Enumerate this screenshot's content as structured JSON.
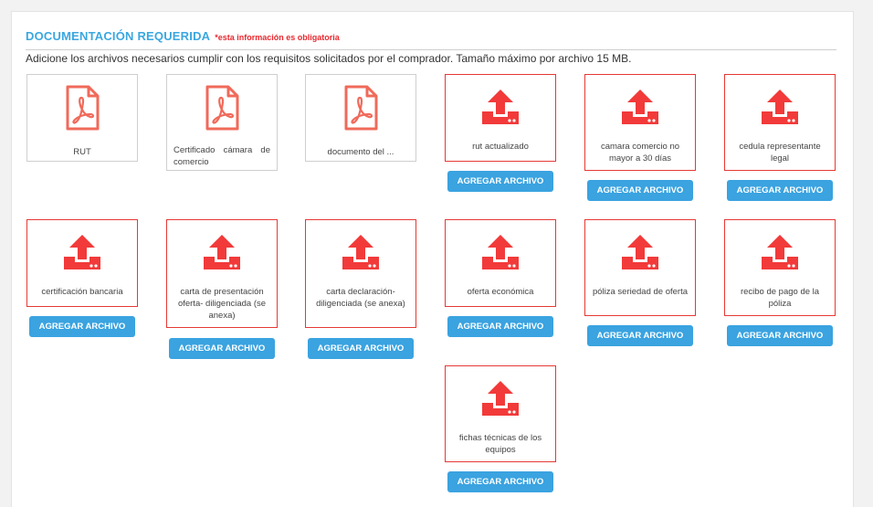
{
  "section": {
    "title": "DOCUMENTACIÓN REQUERIDA",
    "required_note": "*esta información es obligatoria",
    "description": "Adicione los archivos necesarios cumplir con los requisitos solicitados por el comprador. Tamaño máximo por archivo 15 MB."
  },
  "colors": {
    "accent": "#3aa7e0",
    "button": "#3aa3e0",
    "required": "#e8282e",
    "upload_icon": "#f23a3a",
    "pdf_icon": "#f06a5a"
  },
  "button_label": "AGREGAR ARCHIVO",
  "documents": [
    {
      "label": "RUT",
      "status": "uploaded",
      "icon": "pdf-icon"
    },
    {
      "label": "Certificado     cámara de comercio",
      "status": "uploaded",
      "icon": "pdf-icon"
    },
    {
      "label": "documento del ...",
      "status": "uploaded",
      "icon": "pdf-icon"
    },
    {
      "label": "rut actualizado",
      "status": "pending",
      "icon": "upload-icon"
    },
    {
      "label": "camara comercio no mayor a 30 días",
      "status": "pending",
      "icon": "upload-icon"
    },
    {
      "label": "cedula representante legal",
      "status": "pending",
      "icon": "upload-icon"
    },
    {
      "label": "certificación bancaria",
      "status": "pending",
      "icon": "upload-icon"
    },
    {
      "label": "carta de presentación oferta- diligenciada (se anexa)",
      "status": "pending",
      "icon": "upload-icon"
    },
    {
      "label": "carta declaración- diligenciada (se anexa)",
      "status": "pending",
      "icon": "upload-icon"
    },
    {
      "label": "oferta económica",
      "status": "pending",
      "icon": "upload-icon"
    },
    {
      "label": "póliza seriedad de oferta",
      "status": "pending",
      "icon": "upload-icon"
    },
    {
      "label": "recibo de pago de la póliza",
      "status": "pending",
      "icon": "upload-icon"
    },
    {
      "label": "fichas técnicas de los equipos",
      "status": "pending",
      "icon": "upload-icon"
    }
  ]
}
